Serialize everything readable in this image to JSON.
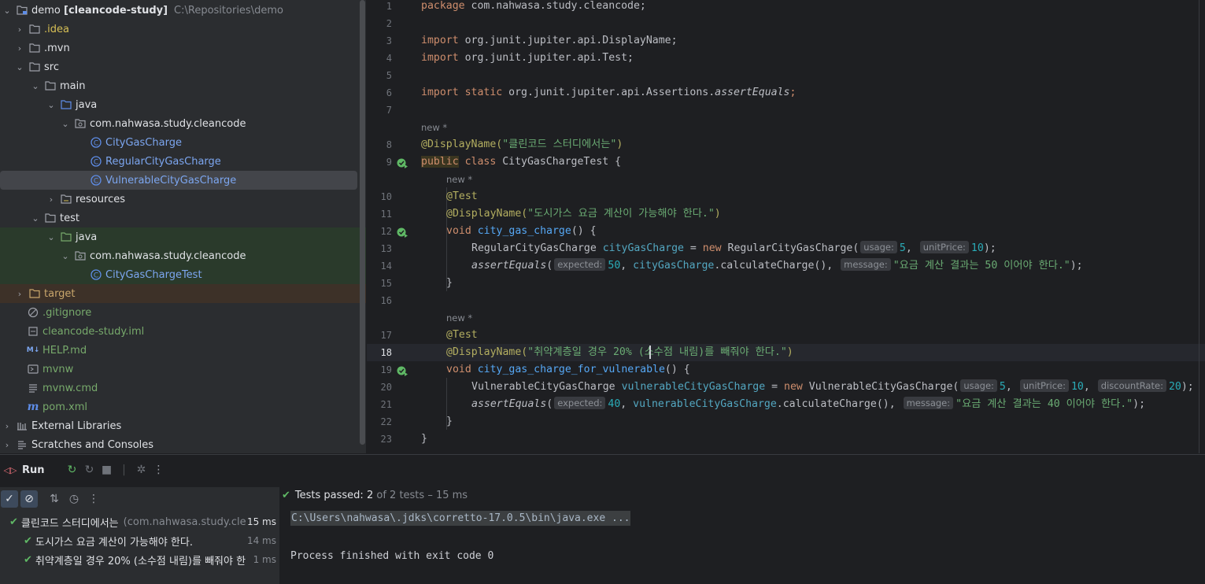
{
  "tree": {
    "root_name": "demo",
    "root_module": "[cleancode-study]",
    "root_path": "C:\\Repositories\\demo",
    "idea": ".idea",
    "mvn": ".mvn",
    "src": "src",
    "main": "main",
    "java_main": "java",
    "pkg_main": "com.nahwasa.study.cleancode",
    "class1": "CityGasCharge",
    "class2": "RegularCityGasCharge",
    "class3": "VulnerableCityGasCharge",
    "resources": "resources",
    "test": "test",
    "java_test": "java",
    "pkg_test": "com.nahwasa.study.cleancode",
    "test_class": "CityGasChargeTest",
    "target": "target",
    "gitignore": ".gitignore",
    "iml": "cleancode-study.iml",
    "help": "HELP.md",
    "mvnw": "mvnw",
    "mvnw_cmd": "mvnw.cmd",
    "pom": "pom.xml",
    "external": "External Libraries",
    "scratches": "Scratches and Consoles"
  },
  "editor": {
    "line_numbers": [
      "1",
      "2",
      "3",
      "4",
      "5",
      "6",
      "7",
      "8",
      "9",
      "10",
      "11",
      "12",
      "13",
      "14",
      "15",
      "16",
      "17",
      "18",
      "19",
      "20",
      "21",
      "22",
      "23"
    ],
    "new_hint": "new *",
    "code": {
      "l1_kw": "package",
      "l1_rest": " com.nahwasa.study.cleancode;",
      "l3_kw": "import",
      "l3_rest": " org.junit.jupiter.api.DisplayName;",
      "l4_kw": "import",
      "l4_rest": " org.junit.jupiter.api.Test;",
      "l6_kw": "import static",
      "l6_rest": " org.junit.jupiter.api.Assertions.",
      "l6_method": "assertEquals",
      "l6_end": ";",
      "l8_ann": "@DisplayName(",
      "l8_str": "\"클린코드 스터디에서는\"",
      "l8_end": ")",
      "l9_kw1": "public",
      "l9_kw2": " class",
      "l9_rest": " CityGasChargeTest {",
      "l10_ann": "@Test",
      "l11_ann": "@DisplayName(",
      "l11_str": "\"도시가스 요금 계산이 가능해야 한다.\"",
      "l11_end": ")",
      "l12_kw": "void",
      "l12_fn": " city_gas_charge",
      "l12_end": "() {",
      "l13_type": "RegularCityGasCharge ",
      "l13_var": "cityGasCharge",
      "l13_eq": " = ",
      "l13_new": "new",
      "l13_ctor": " RegularCityGasCharge(",
      "l13_h1": "usage:",
      "l13_v1": "5",
      "l13_c1": ", ",
      "l13_h2": "unitPrice:",
      "l13_v2": "10",
      "l13_end": ");",
      "l14_fn": "assertEquals",
      "l14_open": "(",
      "l14_h1": "expected:",
      "l14_v1": "50",
      "l14_c1": ", ",
      "l14_var": "cityGasCharge",
      "l14_call": ".calculateCharge(), ",
      "l14_h2": "message:",
      "l14_str": "\"요금 계산 결과는 50 이어야 한다.\"",
      "l14_end": ");",
      "l15": "}",
      "l17_ann": "@Test",
      "l18_ann": "@DisplayName(",
      "l18_str_a": "\"취약계층일 경우 20% (",
      "l18_str_b": "소수점 내림)를 빼줘야 한다.\"",
      "l18_end": ")",
      "l19_kw": "void",
      "l19_fn": " city_gas_charge_for_vulnerable",
      "l19_end": "() {",
      "l20_type": "VulnerableCityGasCharge ",
      "l20_var": "vulnerableCityGasCharge",
      "l20_eq": " = ",
      "l20_new": "new",
      "l20_ctor": " VulnerableCityGasCharge(",
      "l20_h1": "usage:",
      "l20_v1": "5",
      "l20_c1": ", ",
      "l20_h2": "unitPrice:",
      "l20_v2": "10",
      "l20_c2": ", ",
      "l20_h3": "discountRate:",
      "l20_v3": "20",
      "l20_end": ");",
      "l21_fn": "assertEquals",
      "l21_open": "(",
      "l21_h1": "expected:",
      "l21_v1": "40",
      "l21_c1": ", ",
      "l21_var": "vulnerableCityGasCharge",
      "l21_call": ".calculateCharge(), ",
      "l21_h2": "message:",
      "l21_str": "\"요금 계산 결과는 40 이어야 한다.\"",
      "l21_end": ");",
      "l22": "}",
      "l23": "}"
    }
  },
  "run": {
    "title": "Run",
    "passed_label": "Tests passed:",
    "passed_count": "2",
    "passed_total": "of 2 tests",
    "passed_time": "– 15 ms",
    "root_test": "클린코드 스터디에서는",
    "root_class": "(com.nahwasa.study.cle",
    "root_time": "15 ms",
    "test1": "도시가스 요금 계산이 가능해야 한다.",
    "test1_time": "14 ms",
    "test2": "취약계층일 경우 20% (소수점 내림)를 빼줘야 한",
    "test2_time": "1 ms",
    "command": "C:\\Users\\nahwasa\\.jdks\\corretto-17.0.5\\bin\\java.exe ...",
    "exit_msg": "Process finished with exit code 0"
  },
  "colors": {
    "accent_green": "#5fb865",
    "selection": "#43454a",
    "bg": "#1e1f22"
  }
}
